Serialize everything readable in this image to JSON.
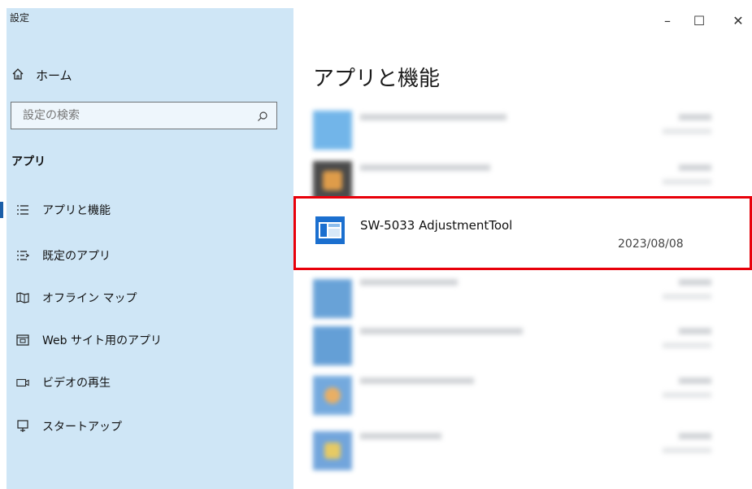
{
  "window": {
    "title": "設定",
    "controls": {
      "minimize": "–",
      "maximize": "☐",
      "close": "✕"
    }
  },
  "sidebar": {
    "home_label": "ホーム",
    "search_placeholder": "設定の検索",
    "section_label": "アプリ",
    "items": [
      {
        "label": "アプリと機能",
        "icon": "apps-features-icon",
        "active": true
      },
      {
        "label": "既定のアプリ",
        "icon": "default-apps-icon"
      },
      {
        "label": "オフライン マップ",
        "icon": "offline-maps-icon"
      },
      {
        "label": "Web サイト用のアプリ",
        "icon": "web-apps-icon"
      },
      {
        "label": "ビデオの再生",
        "icon": "video-playback-icon"
      },
      {
        "label": "スタートアップ",
        "icon": "startup-icon"
      }
    ]
  },
  "main": {
    "title": "アプリと機能",
    "highlighted_app": {
      "name": "SW-5033 AdjustmentTool",
      "date": "2023/08/08"
    }
  },
  "colors": {
    "sidebar_bg": "#cfe6f6",
    "accent": "#1a5ea8",
    "highlight_border": "#e8000a"
  }
}
